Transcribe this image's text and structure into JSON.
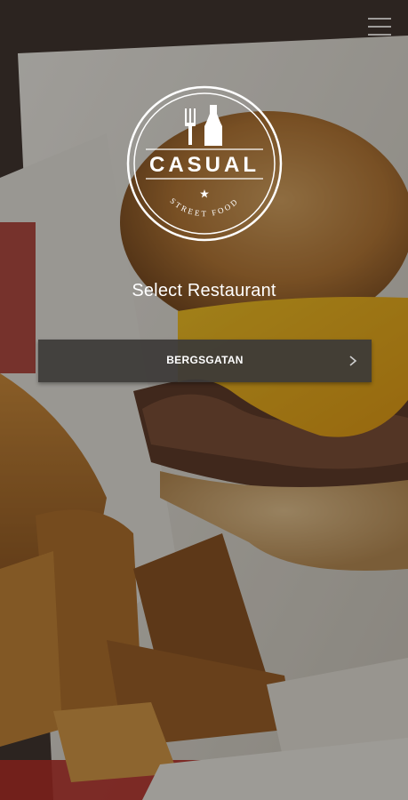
{
  "header": {
    "menu_icon": "hamburger-menu-icon"
  },
  "logo": {
    "brand": "CASUAL",
    "tagline": "STREET FOOD",
    "icons": [
      "fork-icon",
      "bottle-icon",
      "star-icon"
    ]
  },
  "select_title": "Select Restaurant",
  "restaurants": [
    {
      "label": "BERGSGATAN",
      "icon": "chevron-right-icon"
    }
  ]
}
